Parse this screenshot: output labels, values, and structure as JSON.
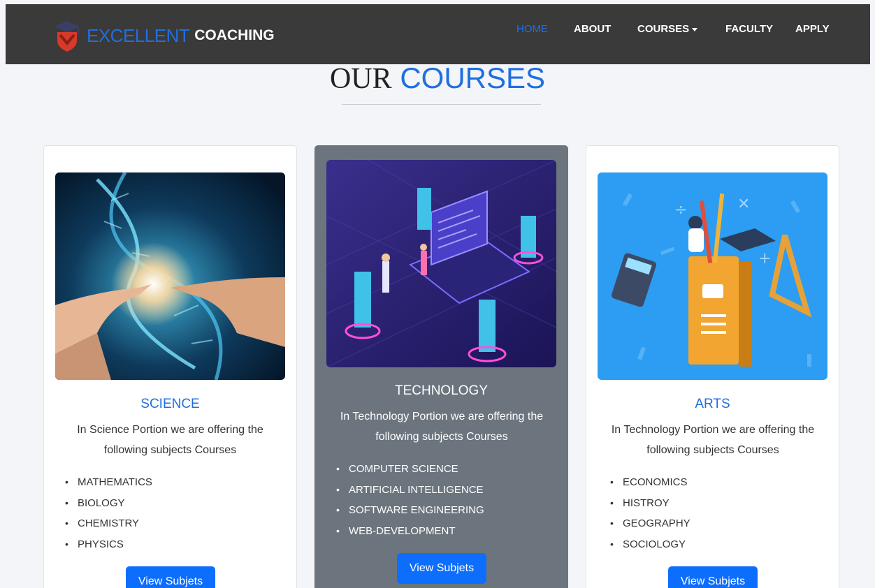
{
  "navbar": {
    "brand_part1": "EXCELLENT",
    "brand_part2": "COACHING",
    "logo_icon": "graduation-cap-shield-logo",
    "items": [
      {
        "label": "HOME",
        "active": true
      },
      {
        "label": "ABOUT",
        "active": false
      },
      {
        "label": "COURSES",
        "active": false,
        "dropdown": true
      },
      {
        "label": "FACULTY",
        "active": false
      },
      {
        "label": "APPLY",
        "active": false
      }
    ],
    "colors": {
      "background": "#3a3a3a",
      "accent": "#1f6fe0"
    }
  },
  "heading": {
    "part1": "OUR",
    "part2": "COURSES"
  },
  "cards": [
    {
      "title": "SCIENCE",
      "description": "In Science Portion we are offering the following subjects Courses",
      "subjects": [
        "MATHEMATICS",
        "BIOLOGY",
        "CHEMISTRY",
        "PHYSICS"
      ],
      "button": "View Subjets",
      "image": "dna-hands-image",
      "style": "light"
    },
    {
      "title": "TECHNOLOGY",
      "description": "In Technology Portion we are offering the following subjects Courses",
      "subjects": [
        "COMPUTER SCIENCE",
        "ARTIFICIAL INTELLIGENCE",
        "SOFTWARE ENGINEERING",
        "WEB-DEVELOPMENT"
      ],
      "button": "View Subjets",
      "image": "isometric-laptop-servers-image",
      "style": "dark"
    },
    {
      "title": "ARTS",
      "description": "In Technology Portion we are offering the following subjects Courses",
      "subjects": [
        "ECONOMICS",
        "HISTROY",
        "GEOGRAPHY",
        "SOCIOLOGY"
      ],
      "button": "View Subjets",
      "image": "books-education-image",
      "style": "light"
    }
  ],
  "colors": {
    "button": "#0d6efd",
    "science_title": "#1f6fe0",
    "arts_title": "#1f6fe0",
    "dark_card": "#6c757d"
  }
}
